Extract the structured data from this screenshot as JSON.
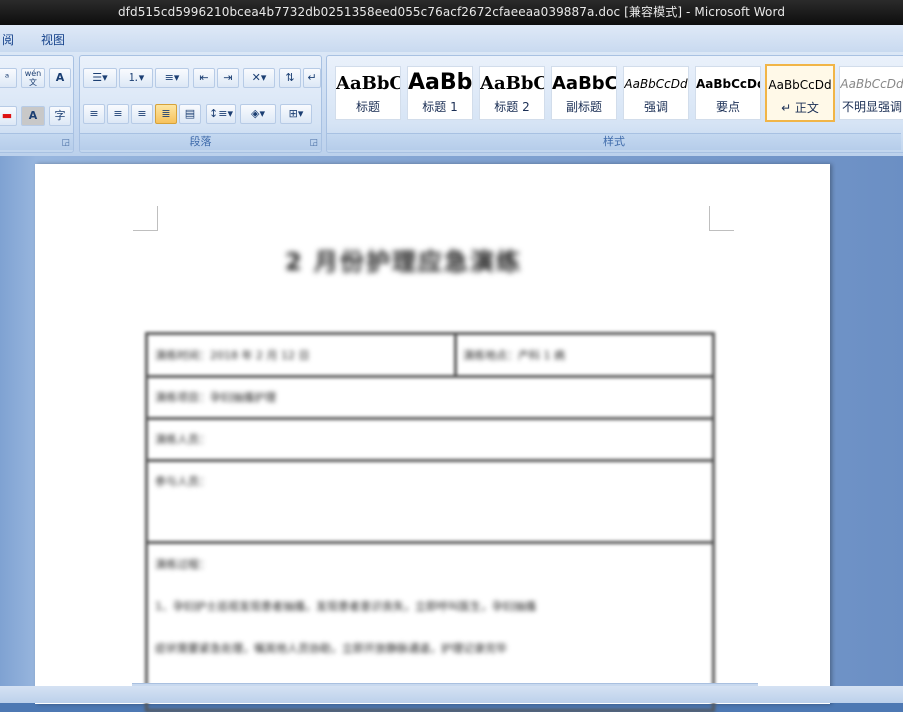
{
  "window": {
    "title": "dfd515cd5996210bcea4b7732db0251358eed055c76acf2672cfaeeaa039887a.doc [兼容模式] - Microsoft Word"
  },
  "tabs": [
    {
      "label": "阅"
    },
    {
      "label": "视图"
    }
  ],
  "ribbon": {
    "groups": {
      "paragraph": {
        "label": "段落"
      },
      "styles": {
        "label": "样式"
      }
    },
    "font_buttons": {
      "phonetic": "wén 文",
      "char_border": "A",
      "char_shading": "A",
      "enclose": "字"
    },
    "styles": [
      {
        "sample": "AaBbC",
        "name": "标题"
      },
      {
        "sample": "AaBb",
        "name": "标题 1"
      },
      {
        "sample": "AaBbC",
        "name": "标题 2"
      },
      {
        "sample": "AaBbC",
        "name": "副标题"
      },
      {
        "sample": "AaBbCcDd",
        "name": "强调"
      },
      {
        "sample": "AaBbCcDd",
        "name": "要点"
      },
      {
        "sample": "AaBbCcDd",
        "name": "↵ 正文"
      },
      {
        "sample": "AaBbCcDd",
        "name": "不明显强调"
      }
    ]
  },
  "document": {
    "title": "2 月份护理应急演练",
    "rows": [
      {
        "left": "演练时间：2018 年 2 月 12 日",
        "right": "演练地点：产科 1 病"
      },
      {
        "left": "演练项目：孕妇抽搐护理"
      },
      {
        "left": "演练人员："
      },
      {
        "left": "参与人员："
      },
      {
        "left": "演练过程："
      },
      {
        "left": "1、孕妇护士巡视发现患者抽搐，发现患者意识丧失，立即呼叫医生，孕妇抽搐"
      },
      {
        "left": "症状需要紧急处理，嘱其他人员协助，立即开放静脉通道，护理记录完毕"
      }
    ]
  }
}
